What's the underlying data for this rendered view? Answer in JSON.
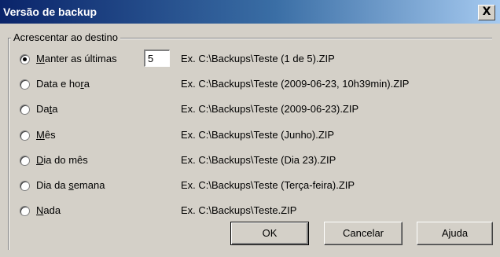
{
  "window": {
    "title": "Versão de backup",
    "close_glyph": "X"
  },
  "group": {
    "label": "Acrescentar ao destino"
  },
  "keep_count": "5",
  "options": [
    {
      "pre": "",
      "acc": "M",
      "post": "anter as últimas",
      "example": "Ex. C:\\Backups\\Teste (1 de 5).ZIP",
      "checked": true
    },
    {
      "pre": "Data e ho",
      "acc": "r",
      "post": "a",
      "example": "Ex. C:\\Backups\\Teste (2009-06-23, 10h39min).ZIP",
      "checked": false
    },
    {
      "pre": "Da",
      "acc": "t",
      "post": "a",
      "example": "Ex. C:\\Backups\\Teste (2009-06-23).ZIP",
      "checked": false
    },
    {
      "pre": "",
      "acc": "M",
      "post": "ês",
      "example": "Ex. C:\\Backups\\Teste (Junho).ZIP",
      "checked": false
    },
    {
      "pre": "",
      "acc": "D",
      "post": "ia do mês",
      "example": "Ex. C:\\Backups\\Teste (Dia 23).ZIP",
      "checked": false
    },
    {
      "pre": "Dia da ",
      "acc": "s",
      "post": "emana",
      "example": "Ex. C:\\Backups\\Teste (Terça-feira).ZIP",
      "checked": false
    },
    {
      "pre": "",
      "acc": "N",
      "post": "ada",
      "example": "Ex. C:\\Backups\\Teste.ZIP",
      "checked": false
    }
  ],
  "buttons": {
    "ok": "OK",
    "cancel": "Cancelar",
    "help": "Ajuda"
  }
}
